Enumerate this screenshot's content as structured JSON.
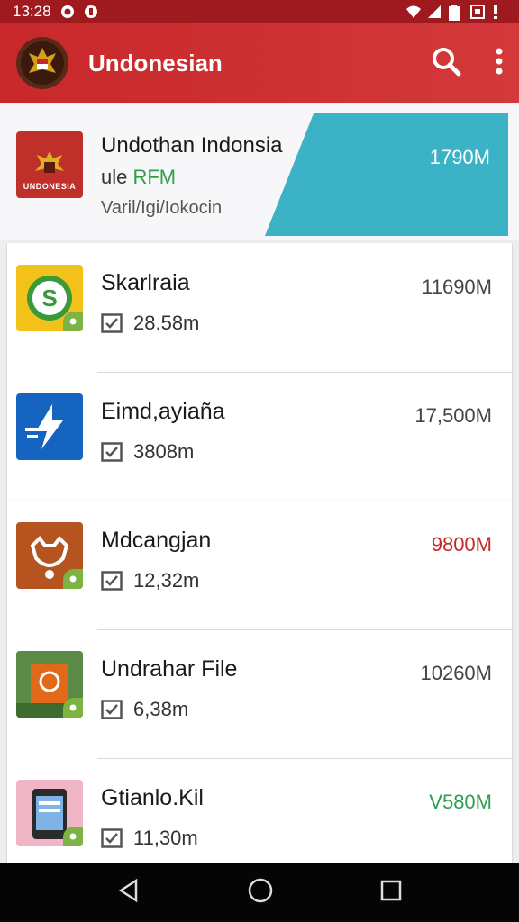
{
  "status_bar": {
    "time": "13:28"
  },
  "app_bar": {
    "title": "Undonesian"
  },
  "featured": {
    "thumb_label": "UNDONESIA",
    "title": "Undothan Indonsia",
    "sub_prefix": "ule ",
    "sub_highlight": "RFM",
    "meta": "Varil/Igi/Iokocin",
    "size": "1790M"
  },
  "items": [
    {
      "name": "Skarlraia",
      "stat": "28.58m",
      "size": "11690M"
    },
    {
      "name": "Eimd,ayiaña",
      "stat": "3808m",
      "size": "17,500M"
    },
    {
      "name": "Mdcangjan",
      "stat": "12,32m",
      "size": "9800M"
    },
    {
      "name": "Undrahar File",
      "stat": "6,38m",
      "size": "10260M"
    },
    {
      "name": "Gtianlo.Kil",
      "stat": "11,30m",
      "size": "V580M"
    }
  ],
  "colors": {
    "app_bar": "#c8282b",
    "status_bar": "#9e1a1f",
    "teal": "#3bb2c6",
    "red_size": "#c62828",
    "green_size": "#2e9e4f",
    "badge": "#7cb342"
  },
  "icons": [
    "whatsapp-icon",
    "notification-icon",
    "wifi-icon",
    "signal-icon",
    "battery-icon",
    "search-icon",
    "more-vert-icon",
    "checkbox-icon",
    "back-icon",
    "home-icon",
    "recents-icon"
  ]
}
